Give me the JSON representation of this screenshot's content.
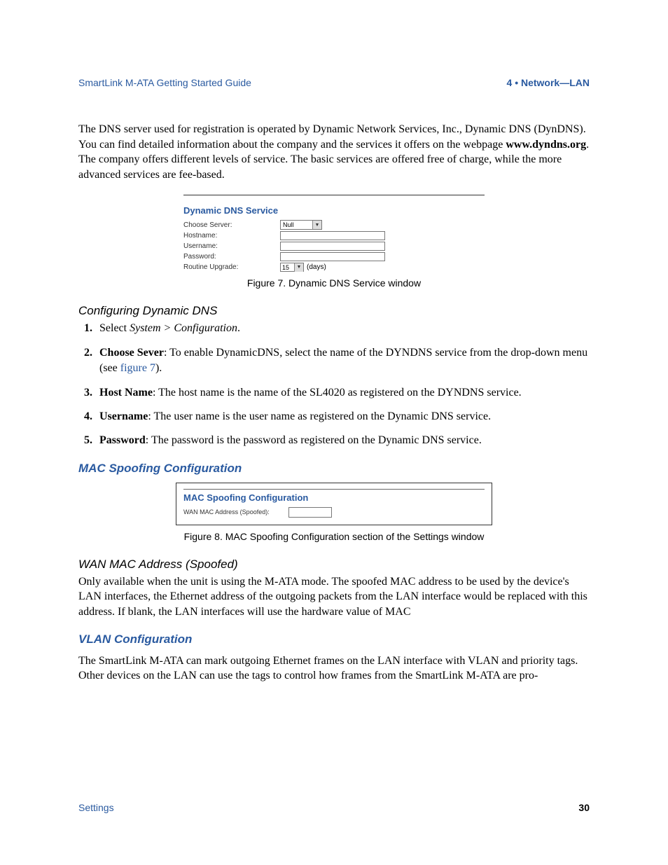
{
  "header": {
    "left": "SmartLink M-ATA Getting Started Guide",
    "right": "4 • Network—LAN"
  },
  "intro": {
    "p1a": "The DNS server used for registration is operated by Dynamic Network Services, Inc., Dynamic DNS (DynDNS). You can find detailed information about the company and the services it offers on the webpage ",
    "p1_bold": "www.dyndns.org",
    "p1b": ". The company offers different levels of service. The basic services are offered free of charge, while the more advanced services are fee-based."
  },
  "fig7": {
    "title": "Dynamic DNS Service",
    "rows": {
      "choose_server": "Choose Server:",
      "hostname": "Hostname:",
      "username": "Username:",
      "password": "Password:",
      "routine_upgrade": "Routine Upgrade:"
    },
    "server_value": "Null",
    "upgrade_value": "15",
    "days": "(days)",
    "caption": "Figure 7. Dynamic DNS Service window"
  },
  "config_dns": {
    "heading": "Configuring Dynamic DNS",
    "steps": [
      {
        "pre": "Select ",
        "em": "System > Configuration",
        "post": "."
      },
      {
        "bold": "Choose Sever",
        "rest": ": To enable DynamicDNS, select the name of the DYNDNS service from the drop-down menu (see ",
        "link": "figure 7",
        "after_link": ")."
      },
      {
        "bold": "Host Name",
        "rest": ": The host name is the name of the SL4020 as registered on the DYNDNS service."
      },
      {
        "bold": "Username",
        "rest": ": The user name is the user name as registered on the Dynamic DNS service."
      },
      {
        "bold": "Password",
        "rest": ": The password is the password as registered on the Dynamic DNS service."
      }
    ]
  },
  "mac_spoof": {
    "heading": "MAC Spoofing Configuration",
    "fig8": {
      "title": "MAC Spoofing Configuration",
      "label": "WAN MAC Address (Spoofed):",
      "caption": "Figure 8. MAC Spoofing Configuration section of the Settings window"
    },
    "subhead": "WAN MAC Address (Spoofed)",
    "para": "Only available when the unit is using the M-ATA mode. The spoofed MAC address to be used by the device's LAN interfaces, the Ethernet address of the outgoing packets from the LAN interface would be replaced with this address. If blank, the LAN interfaces will use the hardware value of MAC"
  },
  "vlan": {
    "heading": "VLAN Configuration",
    "para": "The SmartLink M-ATA can mark outgoing Ethernet frames on the LAN interface with VLAN and priority tags. Other devices on the LAN can use the tags to control how frames from the SmartLink M-ATA are pro-"
  },
  "footer": {
    "left": "Settings",
    "right": "30"
  }
}
